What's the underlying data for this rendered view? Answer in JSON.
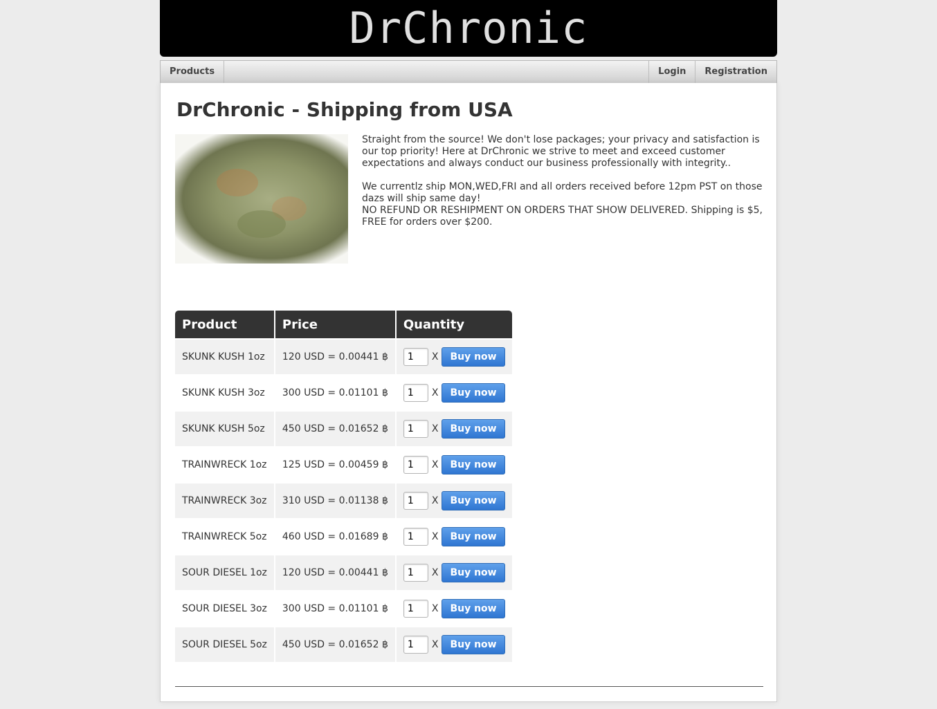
{
  "header": {
    "brand": "DrChronic"
  },
  "nav": {
    "left": [
      {
        "label": "Products"
      }
    ],
    "right": [
      {
        "label": "Login"
      },
      {
        "label": "Registration"
      }
    ]
  },
  "main": {
    "title": "DrChronic - Shipping from USA",
    "description": [
      "Straight from the source! We don't lose packages; your privacy and satisfaction is our top priority! Here at DrChronic we strive to meet and exceed customer expectations and always conduct our business professionally with integrity..",
      "We currentlz ship MON,WED,FRI and all orders received before 12pm PST on those dazs will ship same day!",
      "NO REFUND OR RESHIPMENT ON ORDERS THAT SHOW DELIVERED. Shipping is $5, FREE for orders over $200."
    ]
  },
  "table": {
    "headers": [
      "Product",
      "Price",
      "Quantity"
    ],
    "times_label": "X",
    "buy_label": "Buy now",
    "rows": [
      {
        "product": "SKUNK KUSH 1oz",
        "price": "120 USD = 0.00441 ฿",
        "quantity": "1"
      },
      {
        "product": "SKUNK KUSH 3oz",
        "price": "300 USD = 0.01101 ฿",
        "quantity": "1"
      },
      {
        "product": "SKUNK KUSH 5oz",
        "price": "450 USD = 0.01652 ฿",
        "quantity": "1"
      },
      {
        "product": "TRAINWRECK 1oz",
        "price": "125 USD = 0.00459 ฿",
        "quantity": "1"
      },
      {
        "product": "TRAINWRECK 3oz",
        "price": "310 USD = 0.01138 ฿",
        "quantity": "1"
      },
      {
        "product": "TRAINWRECK 5oz",
        "price": "460 USD = 0.01689 ฿",
        "quantity": "1"
      },
      {
        "product": "SOUR DIESEL 1oz",
        "price": "120 USD = 0.00441 ฿",
        "quantity": "1"
      },
      {
        "product": "SOUR DIESEL 3oz",
        "price": "300 USD = 0.01101 ฿",
        "quantity": "1"
      },
      {
        "product": "SOUR DIESEL 5oz",
        "price": "450 USD = 0.01652 ฿",
        "quantity": "1"
      }
    ]
  },
  "colors": {
    "banner_bg": "#000000",
    "table_header_bg": "#333333",
    "buy_button": "#2f76d2"
  }
}
